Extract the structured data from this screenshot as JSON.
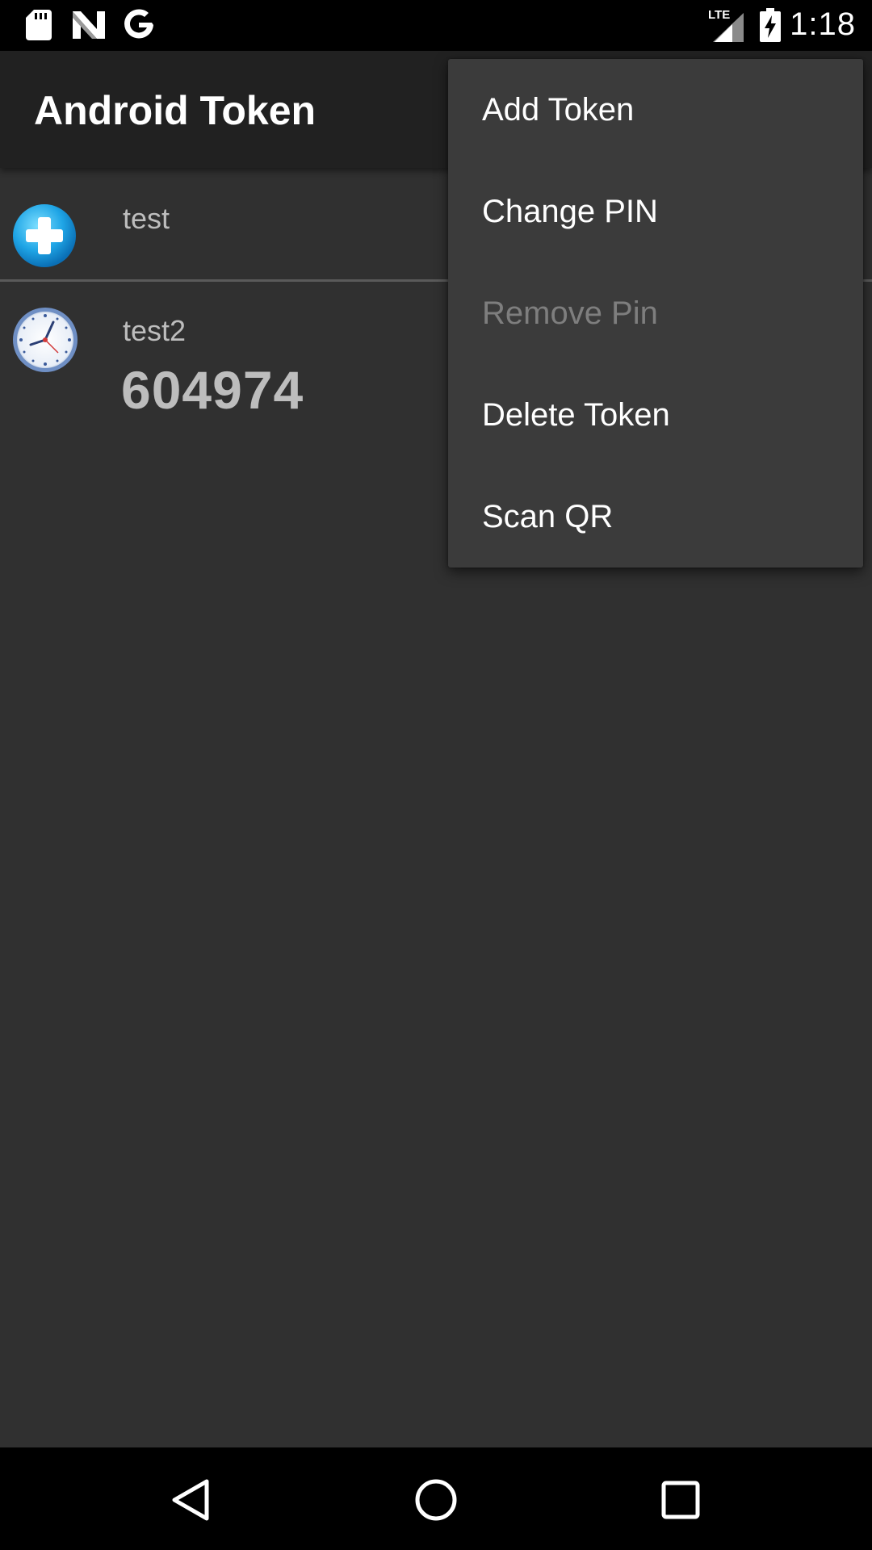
{
  "status_bar": {
    "time": "1:18",
    "network_label": "LTE",
    "icons": [
      "sd-card-icon",
      "n-notification-icon",
      "google-icon",
      "lte-signal-icon",
      "battery-charging-icon"
    ]
  },
  "app_bar": {
    "title": "Android Token"
  },
  "tokens": [
    {
      "name": "test",
      "code": "",
      "icon": "event-token-icon"
    },
    {
      "name": "test2",
      "code": "604974",
      "icon": "time-token-icon"
    }
  ],
  "menu": {
    "items": [
      {
        "label": "Add Token",
        "enabled": true
      },
      {
        "label": "Change PIN",
        "enabled": true
      },
      {
        "label": "Remove Pin",
        "enabled": false
      },
      {
        "label": "Delete Token",
        "enabled": true
      },
      {
        "label": "Scan QR",
        "enabled": true
      }
    ]
  },
  "nav_bar": {
    "buttons": [
      "back-icon",
      "home-icon",
      "recents-icon"
    ]
  },
  "colors": {
    "background": "#303030",
    "action_bar": "#212121",
    "menu_background": "#3b3b3b",
    "disabled_text": "#7e7e7e"
  }
}
